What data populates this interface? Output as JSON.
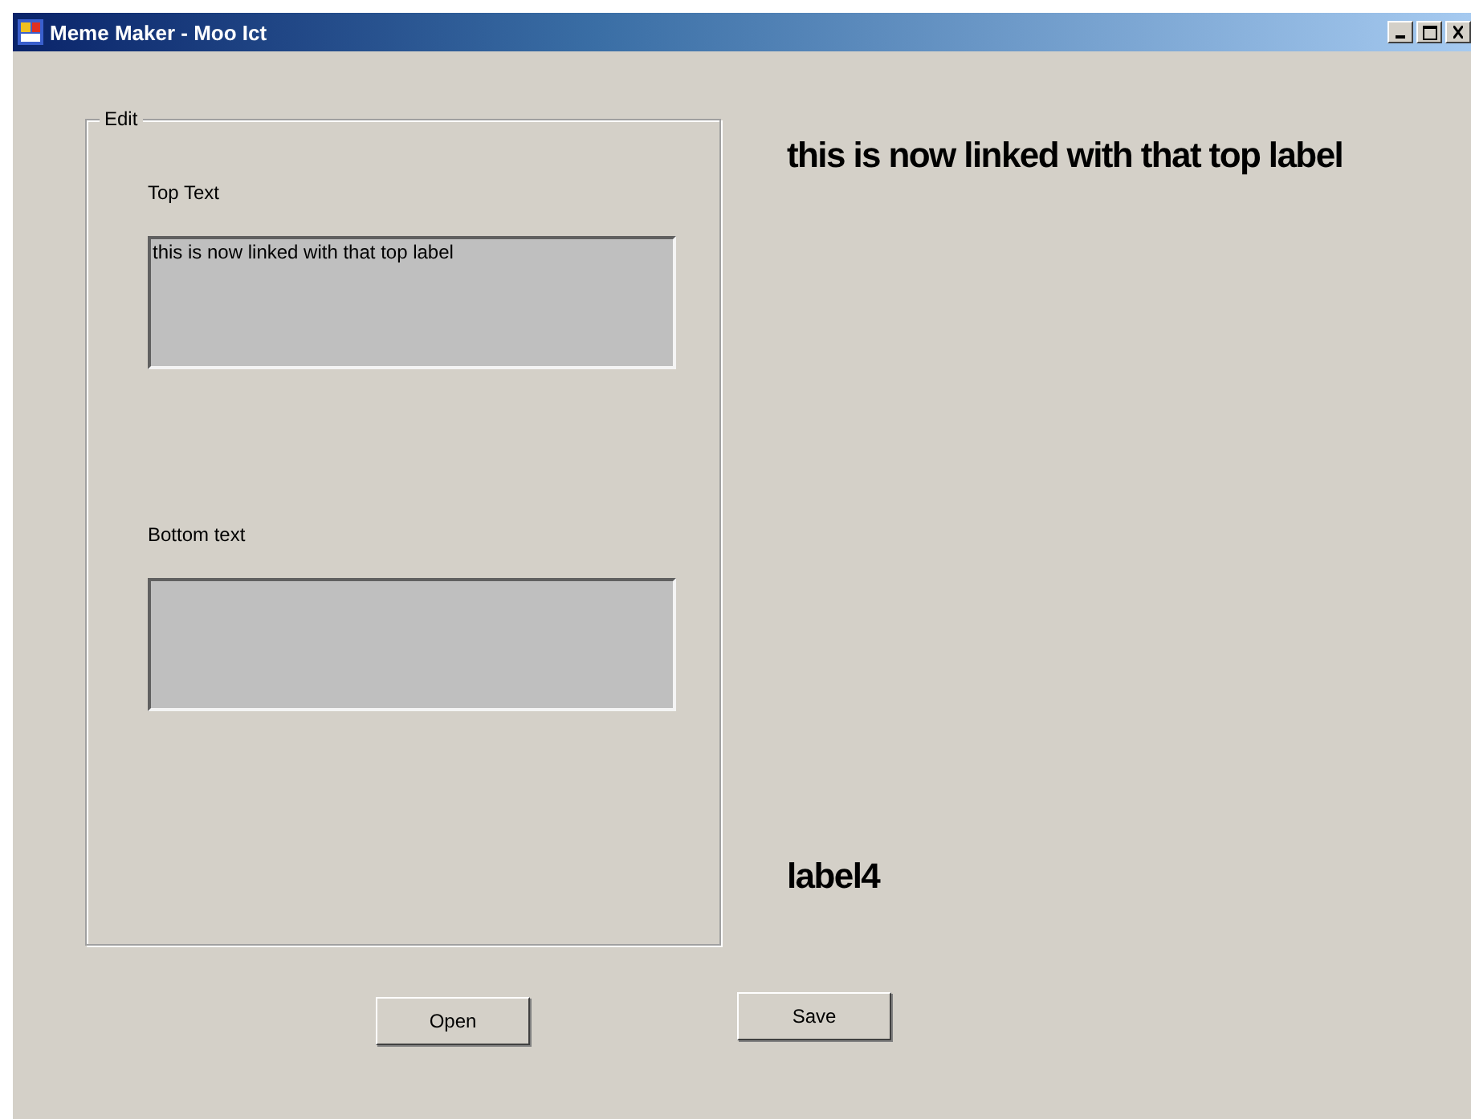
{
  "window": {
    "title": "Meme Maker - Moo Ict"
  },
  "group": {
    "title": "Edit",
    "fields": [
      {
        "label": "Top Text",
        "value": "this is now linked with that top label"
      },
      {
        "label": "Bottom text"
      }
    ]
  },
  "meme": {
    "top_label": "this is now linked with that top label",
    "bottom_label": "label4"
  },
  "buttons": [
    "Open",
    "Save"
  ]
}
